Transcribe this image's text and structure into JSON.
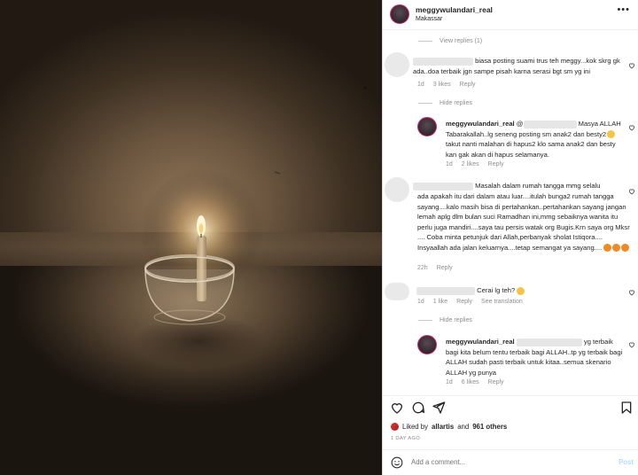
{
  "post": {
    "username": "meggywulandari_real",
    "location": "Makassar"
  },
  "comments": {
    "view_replies_1": "View replies (1)",
    "c1": {
      "text": "biasa posting suami trus teh meggy...kok skrg gk ada..doa terbaik jgn sampe pisah karna serasi bgt sm yg ini",
      "time": "1d",
      "likes": "3 likes",
      "reply": "Reply"
    },
    "hide_replies_1": "Hide replies",
    "r1": {
      "username": "meggywulandari_real",
      "mention": "@",
      "text_after_mention": "Masya ALLAH Tabarakallah..lg seneng posting sm anak2 dan besty2",
      "text_end": "takut nanti malahan di hapus2 klo sama anak2 dan besty kan gak akan di hapus selamanya.",
      "time": "1d",
      "likes": "2 likes",
      "reply": "Reply"
    },
    "c2": {
      "text_first": "Masalah dalam rumah tangga mmg selalu",
      "text_rest": "ada apakah itu dari dalam atau luar....itulah bunga2 rumah tangga sayang....kalo masih bisa di pertahankan..pertahankan sayang jangan lemah aplg dlm bulan suci Ramadhan ini,mmg sebaiknya wanita itu perlu juga mandiri....saya tau persis watak org Bugis.Krn saya org Mksr .... Coba minta petunjuk dari Allah,perbanyak sholat Istiqora.... Insyaallah ada jalan keluarnya....tetap semangat ya sayang....",
      "time": "22h",
      "reply": "Reply"
    },
    "c3": {
      "text": "Cerai lg teh?",
      "time": "1d",
      "likes": "1 like",
      "reply": "Reply",
      "see_translation": "See translation"
    },
    "hide_replies_2": "Hide replies",
    "r2": {
      "username": "meggywulandari_real",
      "text_first": "yg terbaik",
      "text_rest": "bagi kita belum tentu terbaik bagi ALLAH..tp yg terbaik bagi ALLAH sudah pasti terbaik untuk kitaa..semua skenario ALLAH yg punya",
      "time": "1d",
      "likes": "6 likes",
      "reply": "Reply"
    }
  },
  "likes": {
    "liked_by_prefix": "Liked by",
    "liked_by_user": "allartis",
    "and": "and",
    "others": "961 others"
  },
  "time_ago": "1 DAY AGO",
  "add_comment": {
    "placeholder": "Add a comment...",
    "post_label": "Post"
  },
  "colors": {
    "link_blue": "#b3dbff",
    "meta_gray": "#8e8e8e",
    "text": "#262626",
    "emoji_yellow": "#f6c445"
  }
}
